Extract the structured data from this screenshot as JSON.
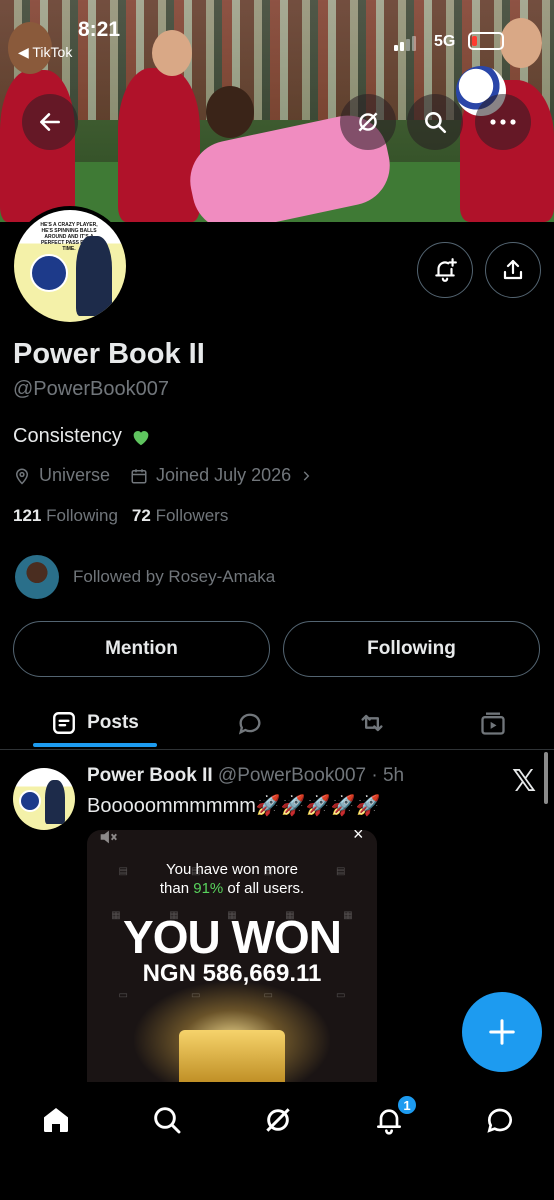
{
  "status_bar": {
    "time": "8:21",
    "back_app": "◀ TikTok",
    "network": "5G"
  },
  "profile": {
    "display_name": "Power Book II",
    "handle": "@PowerBook007",
    "bio": "Consistency",
    "location": "Universe",
    "joined": "Joined July 2026",
    "following_count": "121",
    "following_label": "Following",
    "followers_count": "72",
    "followers_label": "Followers",
    "followed_by": "Followed by Rosey-Amaka",
    "avatar_caption": "HE'S A CRAZY PLAYER, HE'S SPINNING BALLS AROUND AND IT'S A PERFECT PASS EVERY TIME."
  },
  "actions": {
    "mention": "Mention",
    "following": "Following"
  },
  "tabs": {
    "posts": "Posts"
  },
  "post": {
    "author": "Power Book II",
    "handle_time": "@PowerBook007 · 5h",
    "text": "Booooommmmmm🚀🚀🚀🚀🚀",
    "media": {
      "subtitle_line1": "You have won more",
      "subtitle_pre": "than ",
      "subtitle_pct": "91%",
      "subtitle_post": " of all users.",
      "headline": "YOU WON",
      "amount": "NGN 586,669.11"
    }
  },
  "nav": {
    "notification_badge": "1"
  },
  "colors": {
    "accent": "#1d9bf0",
    "background": "#000000",
    "muted": "#71767b",
    "heart": "#5fc45f"
  }
}
